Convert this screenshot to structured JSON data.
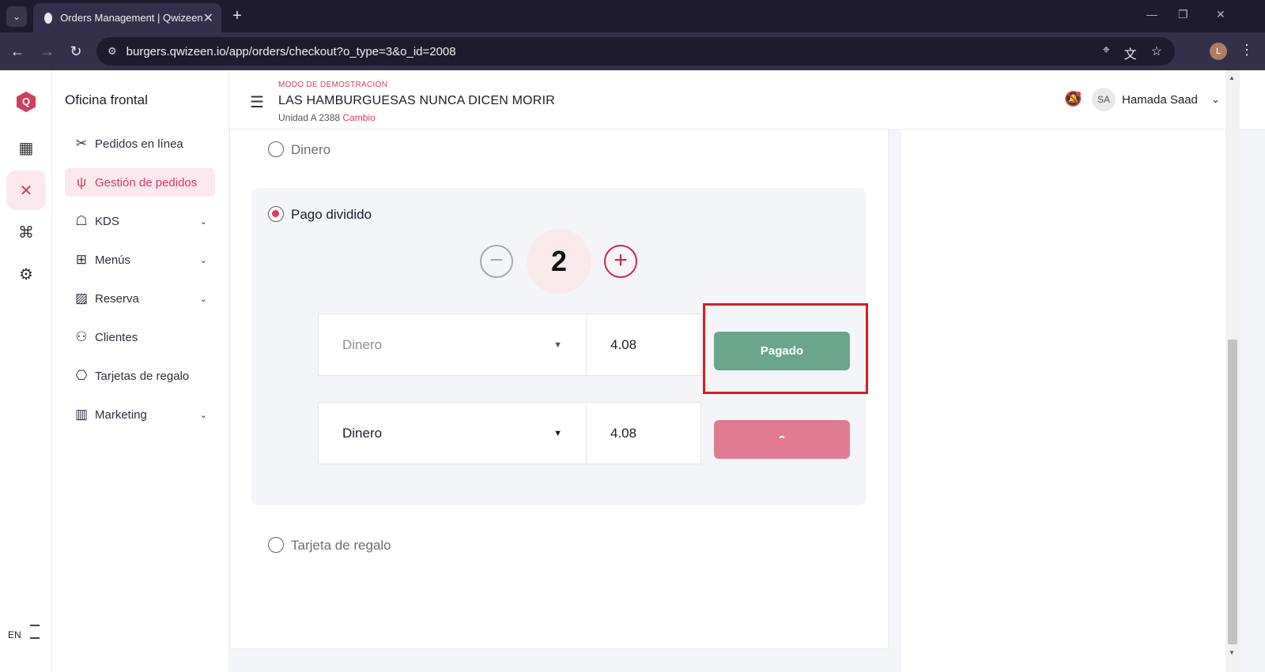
{
  "browser": {
    "tab_title": "Orders Management | Qwizeen",
    "tab_close": "✕",
    "new_tab": "+",
    "url": "burgers.qwizeen.io/app/orders/checkout?o_type=3&o_id=2008",
    "profile_initial": "L"
  },
  "rail": {
    "logo": "Q",
    "lang": "EN"
  },
  "menu": {
    "title": "Oficina frontal",
    "items": [
      {
        "label": "Pedidos en línea",
        "icon": "utensils-crossed-icon"
      },
      {
        "label": "Gestión de pedidos",
        "icon": "fork-knife-icon"
      },
      {
        "label": "KDS",
        "icon": "chef-hat-icon"
      },
      {
        "label": "Menús",
        "icon": "grid-icon"
      },
      {
        "label": "Reserva",
        "icon": "table-icon"
      },
      {
        "label": "Clientes",
        "icon": "users-icon"
      },
      {
        "label": "Tarjetas de regalo",
        "icon": "gift-icon"
      },
      {
        "label": "Marketing",
        "icon": "bar-chart-icon"
      }
    ]
  },
  "header": {
    "demo_label": "MODO DE DEMOSTRACIÓN",
    "restaurant_name": "LAS HAMBURGUESAS NUNCA DICEN MORIR",
    "unit": "Unidad A 2388",
    "unit_link": "Cambio",
    "avatar_initials": "SA",
    "user_name": "Hamada Saad"
  },
  "checkout": {
    "option_cash": "Dinero",
    "option_split": "Pago dividido",
    "option_gift": "Tarjeta de regalo",
    "split_count": "2",
    "stepper_minus": "−",
    "stepper_plus": "+",
    "rows": [
      {
        "method": "Dinero",
        "amount": "4.08",
        "button": "Pagado",
        "status": "paid"
      },
      {
        "method": "Dinero",
        "amount": "4.08",
        "button": "",
        "status": "loading"
      }
    ]
  },
  "colors": {
    "accent": "#d43d5b",
    "paid": "#6aa58c",
    "pending": "#e07c91",
    "highlight": "#d91c24"
  }
}
